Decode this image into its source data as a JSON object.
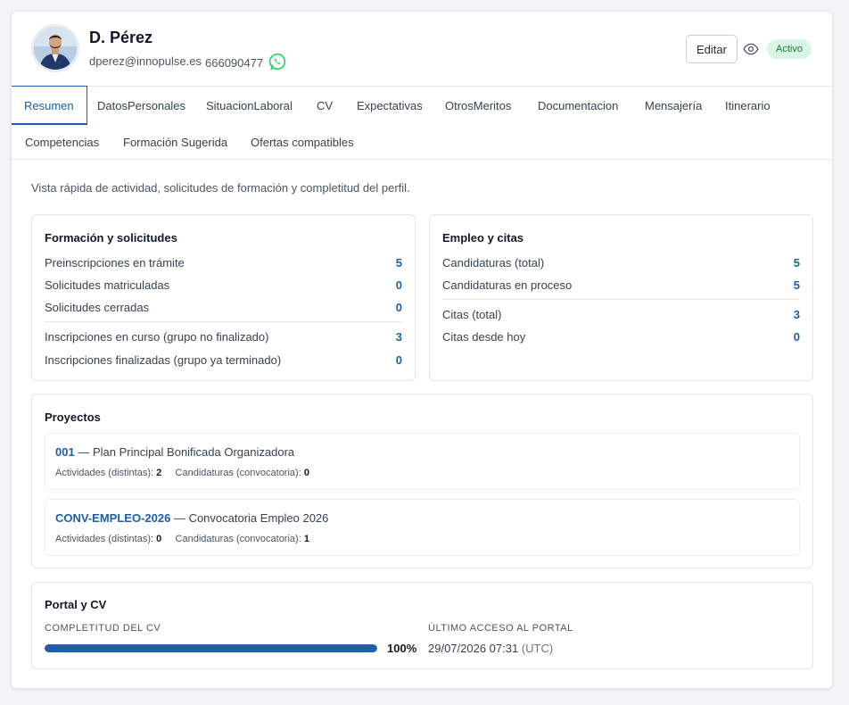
{
  "profile": {
    "name": "D. Pérez",
    "email": "dperez@innopulse.es",
    "phone": "666090477",
    "status": "Activo",
    "edit_label": "Editar"
  },
  "icons": {
    "avatar": "avatar",
    "whatsapp": "whatsapp-icon",
    "eye": "eye-icon"
  },
  "colors": {
    "accent": "#1d5fa8",
    "status_bg": "#d9f5e4",
    "status_fg": "#127a3e",
    "whatsapp": "#25d366"
  },
  "tabs": [
    {
      "label": "Resumen",
      "active": true
    },
    {
      "label": "DatosPersonales"
    },
    {
      "label": "SituacionLaboral"
    },
    {
      "label": "CV"
    },
    {
      "label": "Expectativas"
    },
    {
      "label": "OtrosMeritos"
    },
    {
      "label": "Documentacion"
    },
    {
      "label": "Mensajería"
    },
    {
      "label": "Itinerario"
    },
    {
      "label": "Competencias"
    },
    {
      "label": "Formación Sugerida"
    },
    {
      "label": "Ofertas compatibles"
    }
  ],
  "intro": "Vista rápida de actividad, solicitudes de formación y completitud del perfil.",
  "formacion": {
    "title": "Formación y solicitudes",
    "rows": [
      {
        "label": "Preinscripciones en trámite",
        "value": "5"
      },
      {
        "label": "Solicitudes matriculadas",
        "value": "0"
      },
      {
        "label": "Solicitudes cerradas",
        "value": "0"
      },
      {
        "label": "Inscripciones en curso (grupo no finalizado)",
        "value": "3"
      },
      {
        "label": "Inscripciones finalizadas (grupo ya terminado)",
        "value": "0"
      }
    ]
  },
  "empleo": {
    "title": "Empleo y citas",
    "rows": [
      {
        "label": "Candidaturas (total)",
        "value": "5"
      },
      {
        "label": "Candidaturas en proceso",
        "value": "5"
      },
      {
        "label": "Citas (total)",
        "value": "3"
      },
      {
        "label": "Citas desde hoy",
        "value": "0"
      }
    ]
  },
  "proyectos": {
    "title": "Proyectos",
    "activities_label": "Actividades (distintas):",
    "candidaturas_label": "Candidaturas (convocatoria):",
    "items": [
      {
        "code": "001",
        "name": "— Plan Principal Bonificada Organizadora",
        "activities": "2",
        "candidaturas": "0"
      },
      {
        "code": "CONV-EMPLEO-2026",
        "name": "— Convocatoria Empleo 2026",
        "activities": "0",
        "candidaturas": "1"
      }
    ]
  },
  "portal": {
    "title": "Portal y CV",
    "cv_label": "COMPLETITUD DEL CV",
    "cv_percent": 100,
    "cv_percent_text": "100%",
    "access_label": "ÚLTIMO ACCESO AL PORTAL",
    "access_value": "29/07/2026 07:31",
    "access_tz": "(UTC)"
  }
}
